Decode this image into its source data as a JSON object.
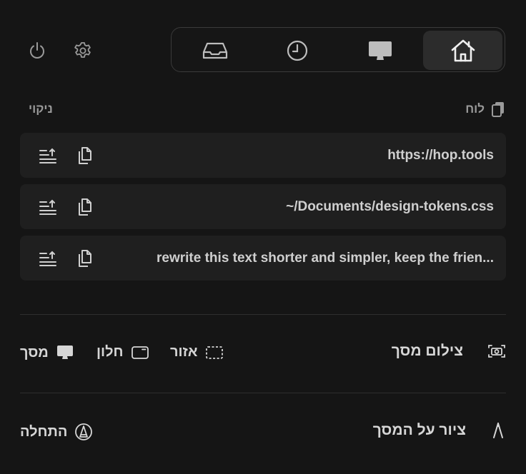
{
  "nav": {
    "tabs": [
      {
        "name": "inbox",
        "icon": "tray-icon"
      },
      {
        "name": "history",
        "icon": "clock-icon"
      },
      {
        "name": "screen",
        "icon": "monitor-icon"
      },
      {
        "name": "home",
        "icon": "house-icon",
        "active": true
      }
    ]
  },
  "clipboard": {
    "title": "לוח",
    "clear_label": "ניקוי",
    "items": [
      {
        "text": "https://hop.tools"
      },
      {
        "text": "~/Documents/design-tokens.css"
      },
      {
        "text": "rewrite this text shorter and simpler, keep the frien..."
      }
    ]
  },
  "screenshot": {
    "title": "צילום מסך",
    "options": {
      "area": "אזור",
      "window": "חלון",
      "screen": "מסך"
    }
  },
  "draw": {
    "title": "ציור על המסך",
    "start_label": "התחלה"
  },
  "colors": {
    "background": "#151515",
    "row_background": "#1f1f1f",
    "active_tab": "#2c2c2c",
    "text": "#d4d4d4",
    "muted_text": "#9a9a9a"
  }
}
